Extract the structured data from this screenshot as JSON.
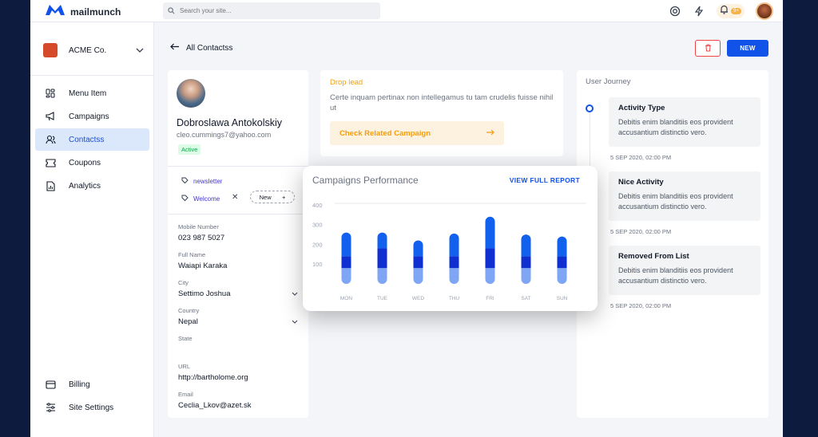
{
  "app": {
    "name": "mailmunch"
  },
  "search": {
    "placeholder": "Search your site..."
  },
  "notifications": {
    "badge": "9+"
  },
  "org": {
    "name": "ACME Co."
  },
  "sidebar": {
    "items": [
      {
        "label": "Menu Item",
        "icon": "menu-grid-icon",
        "active": false
      },
      {
        "label": "Campaigns",
        "icon": "megaphone-icon",
        "active": false
      },
      {
        "label": "Contactss",
        "icon": "users-icon",
        "active": true
      },
      {
        "label": "Coupons",
        "icon": "ticket-icon",
        "active": false
      },
      {
        "label": "Analytics",
        "icon": "chart-file-icon",
        "active": false
      }
    ],
    "bottom": [
      {
        "label": "Billing",
        "icon": "credit-card-icon"
      },
      {
        "label": "Site Settings",
        "icon": "sliders-icon"
      }
    ]
  },
  "header": {
    "back_label": "All Contactss",
    "new_label": "NEW"
  },
  "contact": {
    "name": "Dobroslawa Antokolskiy",
    "email": "cleo.cummings7@yahoo.com",
    "status": "Active",
    "tags": [
      "newsletter",
      "Welcome"
    ],
    "new_tag_label": "New",
    "fields": [
      {
        "label": "Mobile Number",
        "value": "023 987 5027"
      },
      {
        "label": "Full Name",
        "value": "Waiapi Karaka"
      },
      {
        "label": "City",
        "value": "Settimo Joshua"
      },
      {
        "label": "Country",
        "value": "Nepal"
      },
      {
        "label": "State",
        "value": ""
      },
      {
        "label": "URL",
        "value": "http://bartholome.org"
      },
      {
        "label": "Email",
        "value": "Ceclia_Lkov@azet.sk"
      }
    ]
  },
  "drop_lead": {
    "title": "Drop lead",
    "text": "Certe inquam pertinax non intellegamus tu tam crudelis fuisse nihil ut",
    "button": "Check Related Campaign"
  },
  "journey": {
    "title": "User Journey",
    "items": [
      {
        "title": "Activity Type",
        "desc": "Debitis enim blanditiis eos provident accusantium distinctio vero.",
        "time": "5 SEP 2020, 02:00 PM"
      },
      {
        "title": "Nice Activity",
        "desc": "Debitis enim blanditiis eos provident accusantium distinctio vero.",
        "time": "5 SEP 2020, 02:00 PM"
      },
      {
        "title": "Removed From List",
        "desc": "Debitis enim blanditiis eos provident accusantium distinctio vero.",
        "time": "5 SEP 2020, 02:00 PM"
      }
    ]
  },
  "performance": {
    "title": "Campaigns Performance",
    "link": "VIEW FULL REPORT"
  },
  "chart_data": {
    "type": "bar",
    "title": "Campaigns Performance",
    "categories": [
      "MON",
      "TUE",
      "WED",
      "THU",
      "FRI",
      "SAT",
      "SUN"
    ],
    "yticks": [
      100,
      200,
      300,
      400
    ],
    "ylim": [
      0,
      420
    ],
    "series": [
      {
        "values": [
          80,
          80,
          80,
          80,
          80,
          80,
          80
        ]
      },
      {
        "values": [
          60,
          100,
          60,
          60,
          100,
          60,
          60
        ]
      },
      {
        "values": [
          120,
          80,
          80,
          115,
          160,
          110,
          100
        ]
      }
    ],
    "colors": [
      "#7fa6f5",
      "#0f2fd0",
      "#1160ee"
    ]
  }
}
